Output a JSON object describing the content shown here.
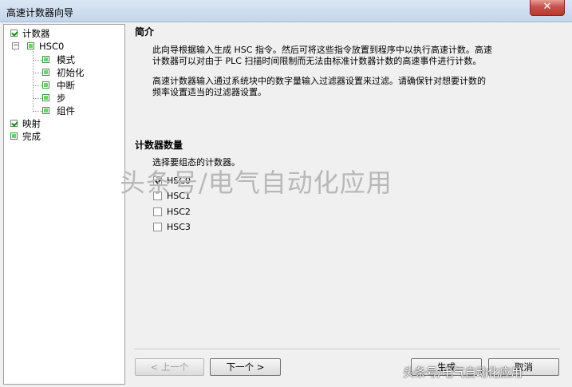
{
  "window": {
    "title": "高速计数器向导",
    "close_glyph": "✕"
  },
  "tree": {
    "counter": "计数器",
    "hsc0": "HSC0",
    "mode": "模式",
    "init": "初始化",
    "interrupt": "中断",
    "step": "步",
    "component": "组件",
    "mapping": "映射",
    "finish": "完成"
  },
  "intro": {
    "heading": "简介",
    "line1": "此向导根据输入生成 HSC 指令。然后可将这些指令放置到程序中以执行高速计数。高速",
    "line2": "计数器可以对由于 PLC 扫描时间限制而无法由标准计数器计数的高速事件进行计数。",
    "line3": "高速计数器输入通过系统块中的数字量输入过滤器设置来过滤。请确保针对想要计数的",
    "line4": "频率设置适当的过滤器设置。"
  },
  "counters": {
    "heading": "计数器数量",
    "instruction": "选择要组态的计数器。",
    "items": [
      {
        "label": "HSC0",
        "checked": true
      },
      {
        "label": "HSC1",
        "checked": false
      },
      {
        "label": "HSC2",
        "checked": false
      },
      {
        "label": "HSC3",
        "checked": false
      }
    ]
  },
  "buttons": {
    "prev": "< 上一个",
    "next": "下一个 >",
    "generate": "生成",
    "cancel": "取消"
  },
  "watermark": {
    "center": "头条号/电气自动化应用",
    "corner": "头条号/电气自动化应用"
  }
}
